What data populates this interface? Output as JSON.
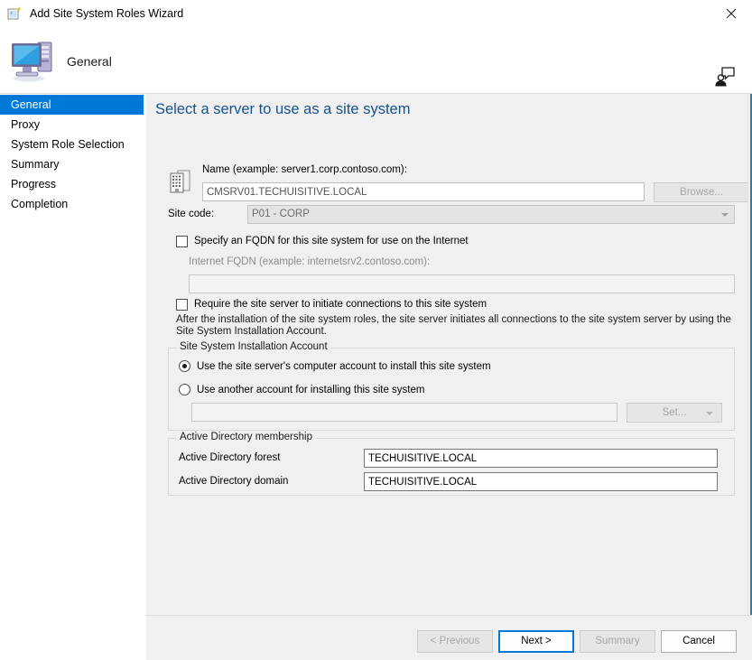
{
  "window": {
    "title": "Add Site System Roles Wizard",
    "title_icon": "wizard-icon",
    "close_label": "✕"
  },
  "header": {
    "title": "General",
    "icon": "site-system-server-icon",
    "help_icon": "feedback-person-icon"
  },
  "sidebar": {
    "items": [
      {
        "label": "General",
        "selected": true
      },
      {
        "label": "Proxy",
        "selected": false
      },
      {
        "label": "System Role Selection",
        "selected": false
      },
      {
        "label": "Summary",
        "selected": false
      },
      {
        "label": "Progress",
        "selected": false
      },
      {
        "label": "Completion",
        "selected": false
      }
    ]
  },
  "main": {
    "heading": "Select a server to use as a site system",
    "server_icon": "server-building-icon",
    "name": {
      "label": "Name (example: server1.corp.contoso.com):",
      "value": "CMSRV01.TECHUISITIVE.LOCAL",
      "browse_label": "Browse..."
    },
    "site_code": {
      "label": "Site code:",
      "value": "P01 - CORP"
    },
    "fqdn": {
      "checkbox_label": "Specify an FQDN for this site system for use on the Internet",
      "checked": false,
      "field_label": "Internet FQDN (example: internetsrv2.contoso.com):",
      "value": "",
      "placeholder": ""
    },
    "require_connections": {
      "checkbox_label": "Require the site server to initiate connections to this site system",
      "checked": false,
      "note": "After the  installation of the site system roles, the site server initiates all connections to the site system server by using the Site System Installation Account."
    },
    "install_account": {
      "group_title": "Site System Installation Account",
      "option_computer_account": "Use the site server's computer account to install this site system",
      "option_another_account": "Use another account for installing this site system",
      "selected_index": 0,
      "account_value": "",
      "set_label": "Set..."
    },
    "active_directory": {
      "group_title": "Active Directory membership",
      "forest_label": "Active Directory forest",
      "forest_value": "TECHUISITIVE.LOCAL",
      "domain_label": "Active Directory domain",
      "domain_value": "TECHUISITIVE.LOCAL"
    }
  },
  "footer": {
    "previous_label": "< Previous",
    "next_label": "Next >",
    "summary_label": "Summary",
    "cancel_label": "Cancel"
  },
  "colors": {
    "accent": "#0078d7",
    "heading": "#18518b",
    "pane_bg": "#f0f0f0"
  }
}
